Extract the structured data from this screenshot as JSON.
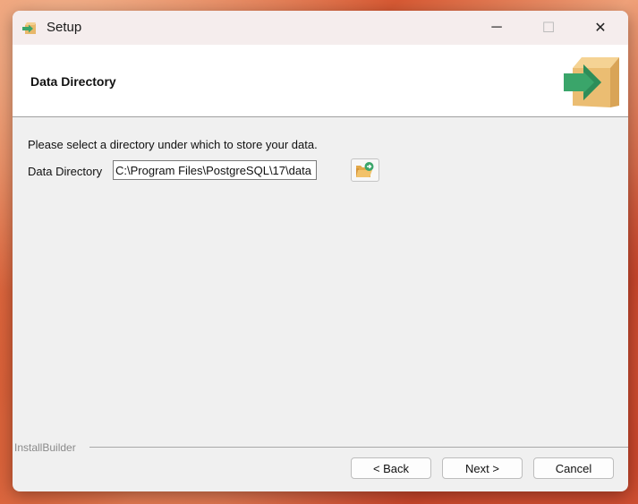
{
  "window": {
    "title": "Setup",
    "app_icon": "installer-box-arrow-icon",
    "controls": {
      "minimize": "─",
      "maximize": "☐",
      "close": "✕"
    }
  },
  "header": {
    "title": "Data Directory",
    "logo": "box-arrow-logo"
  },
  "content": {
    "description": "Please select a directory under which to store your data.",
    "data_directory_label": "Data Directory",
    "data_directory_value": "C:\\Program Files\\PostgreSQL\\17\\data",
    "browse_icon": "folder-browse-icon"
  },
  "footer": {
    "brand": "InstallBuilder",
    "back_label": "< Back",
    "next_label": "Next >",
    "cancel_label": "Cancel"
  },
  "colors": {
    "accent_green": "#3aa56a",
    "box_tan": "#e8b86a",
    "window_bg": "#f0f0f0"
  }
}
